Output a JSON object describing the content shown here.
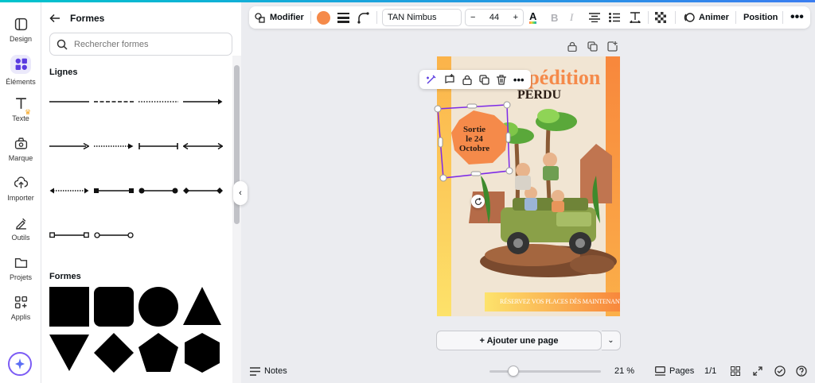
{
  "rail": {
    "items": [
      {
        "label": "Design",
        "icon": "design-icon"
      },
      {
        "label": "Éléments",
        "icon": "elements-icon"
      },
      {
        "label": "Texte",
        "icon": "text-icon"
      },
      {
        "label": "Marque",
        "icon": "brand-icon"
      },
      {
        "label": "Importer",
        "icon": "upload-icon"
      },
      {
        "label": "Outils",
        "icon": "tools-icon"
      },
      {
        "label": "Projets",
        "icon": "folder-icon"
      },
      {
        "label": "Applis",
        "icon": "apps-icon"
      }
    ]
  },
  "panel": {
    "title": "Formes",
    "search_placeholder": "Rechercher formes",
    "section_lines": "Lignes",
    "section_shapes": "Formes"
  },
  "toolbar": {
    "edit_label": "Modifier",
    "font_name": "TAN Nimbus",
    "font_size": "44",
    "minus": "−",
    "plus": "+",
    "animate_label": "Animer",
    "position_label": "Position",
    "color_swatch": "#f58a4a"
  },
  "poster": {
    "title": "Expédition",
    "subtitle": "PERDU",
    "badge": [
      "Sortie",
      "le 24",
      "Octobre"
    ],
    "footer": "RÉSERVEZ VOS PLACES DÈS MAINTENANT !"
  },
  "canvas": {
    "add_page_label": "+ Ajouter une page"
  },
  "bottom": {
    "notes_label": "Notes",
    "zoom": "21 %",
    "pages_label": "Pages",
    "page_count": "1/1"
  }
}
